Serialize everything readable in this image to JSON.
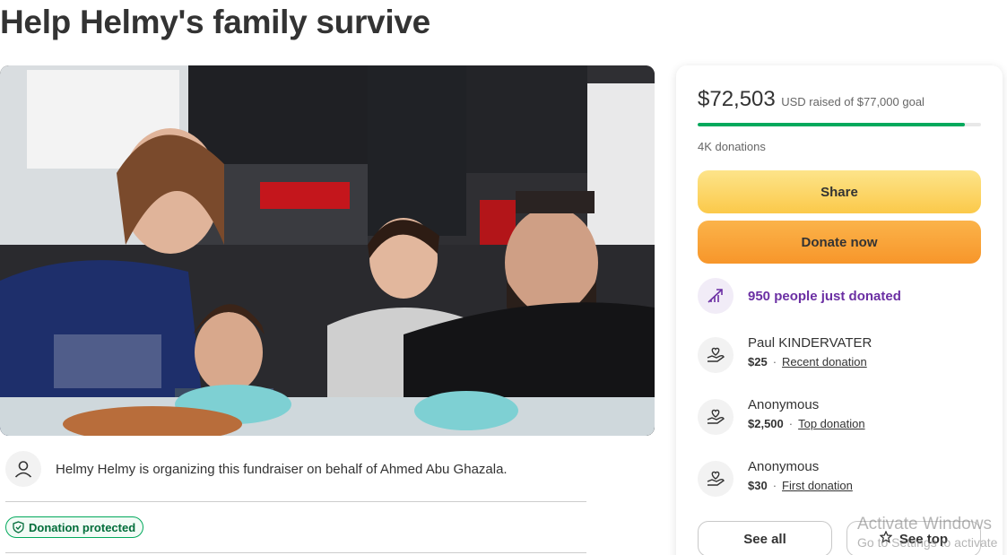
{
  "title": "Help Helmy's family survive",
  "organizer": {
    "text": "Helmy Helmy is organizing this fundraiser on behalf of Ahmed Abu Ghazala."
  },
  "badge": {
    "label": "Donation protected"
  },
  "stats": {
    "raised": "$72,503",
    "raised_sub": "USD raised of $77,000 goal",
    "progress_fraction": 0.9416,
    "donations": "4K donations"
  },
  "buttons": {
    "share": "Share",
    "donate": "Donate now",
    "see_all": "See all",
    "see_top": "See top"
  },
  "trending": {
    "text": "950 people just donated",
    "icon": "trending-up-icon"
  },
  "donors": [
    {
      "name": "Paul KINDERVATER",
      "amount": "$25",
      "tag": "Recent donation"
    },
    {
      "name": "Anonymous",
      "amount": "$2,500",
      "tag": "Top donation"
    },
    {
      "name": "Anonymous",
      "amount": "$30",
      "tag": "First donation"
    }
  ],
  "watermark": {
    "line1": "Activate Windows",
    "line2": "Go to Settings to activate"
  },
  "colors": {
    "brand_green": "#02a95c",
    "purple": "#6b2fa3",
    "share_yellow": "#fbc94a",
    "donate_orange": "#f7962a"
  }
}
